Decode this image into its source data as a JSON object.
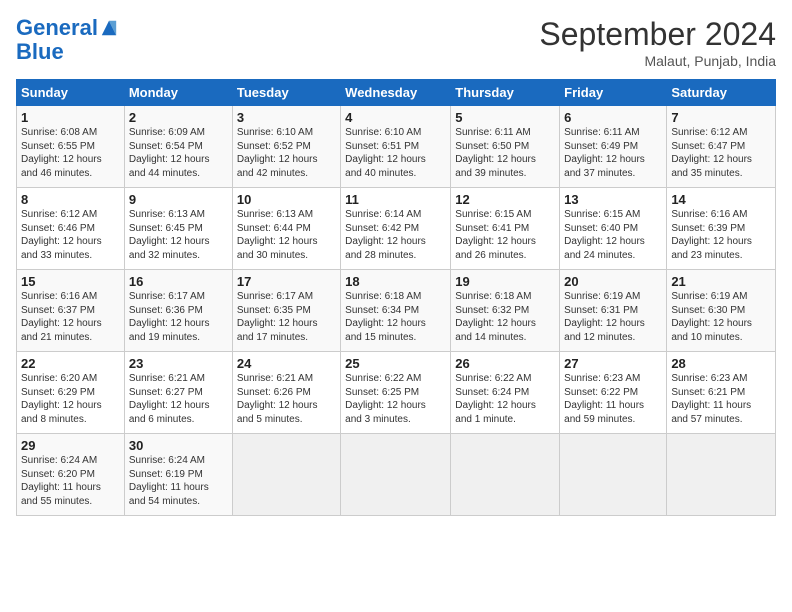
{
  "header": {
    "logo_line1": "General",
    "logo_line2": "Blue",
    "month_title": "September 2024",
    "subtitle": "Malaut, Punjab, India"
  },
  "days_of_week": [
    "Sunday",
    "Monday",
    "Tuesday",
    "Wednesday",
    "Thursday",
    "Friday",
    "Saturday"
  ],
  "weeks": [
    [
      {
        "day": "1",
        "info": "Sunrise: 6:08 AM\nSunset: 6:55 PM\nDaylight: 12 hours\nand 46 minutes."
      },
      {
        "day": "2",
        "info": "Sunrise: 6:09 AM\nSunset: 6:54 PM\nDaylight: 12 hours\nand 44 minutes."
      },
      {
        "day": "3",
        "info": "Sunrise: 6:10 AM\nSunset: 6:52 PM\nDaylight: 12 hours\nand 42 minutes."
      },
      {
        "day": "4",
        "info": "Sunrise: 6:10 AM\nSunset: 6:51 PM\nDaylight: 12 hours\nand 40 minutes."
      },
      {
        "day": "5",
        "info": "Sunrise: 6:11 AM\nSunset: 6:50 PM\nDaylight: 12 hours\nand 39 minutes."
      },
      {
        "day": "6",
        "info": "Sunrise: 6:11 AM\nSunset: 6:49 PM\nDaylight: 12 hours\nand 37 minutes."
      },
      {
        "day": "7",
        "info": "Sunrise: 6:12 AM\nSunset: 6:47 PM\nDaylight: 12 hours\nand 35 minutes."
      }
    ],
    [
      {
        "day": "8",
        "info": "Sunrise: 6:12 AM\nSunset: 6:46 PM\nDaylight: 12 hours\nand 33 minutes."
      },
      {
        "day": "9",
        "info": "Sunrise: 6:13 AM\nSunset: 6:45 PM\nDaylight: 12 hours\nand 32 minutes."
      },
      {
        "day": "10",
        "info": "Sunrise: 6:13 AM\nSunset: 6:44 PM\nDaylight: 12 hours\nand 30 minutes."
      },
      {
        "day": "11",
        "info": "Sunrise: 6:14 AM\nSunset: 6:42 PM\nDaylight: 12 hours\nand 28 minutes."
      },
      {
        "day": "12",
        "info": "Sunrise: 6:15 AM\nSunset: 6:41 PM\nDaylight: 12 hours\nand 26 minutes."
      },
      {
        "day": "13",
        "info": "Sunrise: 6:15 AM\nSunset: 6:40 PM\nDaylight: 12 hours\nand 24 minutes."
      },
      {
        "day": "14",
        "info": "Sunrise: 6:16 AM\nSunset: 6:39 PM\nDaylight: 12 hours\nand 23 minutes."
      }
    ],
    [
      {
        "day": "15",
        "info": "Sunrise: 6:16 AM\nSunset: 6:37 PM\nDaylight: 12 hours\nand 21 minutes."
      },
      {
        "day": "16",
        "info": "Sunrise: 6:17 AM\nSunset: 6:36 PM\nDaylight: 12 hours\nand 19 minutes."
      },
      {
        "day": "17",
        "info": "Sunrise: 6:17 AM\nSunset: 6:35 PM\nDaylight: 12 hours\nand 17 minutes."
      },
      {
        "day": "18",
        "info": "Sunrise: 6:18 AM\nSunset: 6:34 PM\nDaylight: 12 hours\nand 15 minutes."
      },
      {
        "day": "19",
        "info": "Sunrise: 6:18 AM\nSunset: 6:32 PM\nDaylight: 12 hours\nand 14 minutes."
      },
      {
        "day": "20",
        "info": "Sunrise: 6:19 AM\nSunset: 6:31 PM\nDaylight: 12 hours\nand 12 minutes."
      },
      {
        "day": "21",
        "info": "Sunrise: 6:19 AM\nSunset: 6:30 PM\nDaylight: 12 hours\nand 10 minutes."
      }
    ],
    [
      {
        "day": "22",
        "info": "Sunrise: 6:20 AM\nSunset: 6:29 PM\nDaylight: 12 hours\nand 8 minutes."
      },
      {
        "day": "23",
        "info": "Sunrise: 6:21 AM\nSunset: 6:27 PM\nDaylight: 12 hours\nand 6 minutes."
      },
      {
        "day": "24",
        "info": "Sunrise: 6:21 AM\nSunset: 6:26 PM\nDaylight: 12 hours\nand 5 minutes."
      },
      {
        "day": "25",
        "info": "Sunrise: 6:22 AM\nSunset: 6:25 PM\nDaylight: 12 hours\nand 3 minutes."
      },
      {
        "day": "26",
        "info": "Sunrise: 6:22 AM\nSunset: 6:24 PM\nDaylight: 12 hours\nand 1 minute."
      },
      {
        "day": "27",
        "info": "Sunrise: 6:23 AM\nSunset: 6:22 PM\nDaylight: 11 hours\nand 59 minutes."
      },
      {
        "day": "28",
        "info": "Sunrise: 6:23 AM\nSunset: 6:21 PM\nDaylight: 11 hours\nand 57 minutes."
      }
    ],
    [
      {
        "day": "29",
        "info": "Sunrise: 6:24 AM\nSunset: 6:20 PM\nDaylight: 11 hours\nand 55 minutes."
      },
      {
        "day": "30",
        "info": "Sunrise: 6:24 AM\nSunset: 6:19 PM\nDaylight: 11 hours\nand 54 minutes."
      },
      {
        "day": "",
        "info": ""
      },
      {
        "day": "",
        "info": ""
      },
      {
        "day": "",
        "info": ""
      },
      {
        "day": "",
        "info": ""
      },
      {
        "day": "",
        "info": ""
      }
    ]
  ]
}
